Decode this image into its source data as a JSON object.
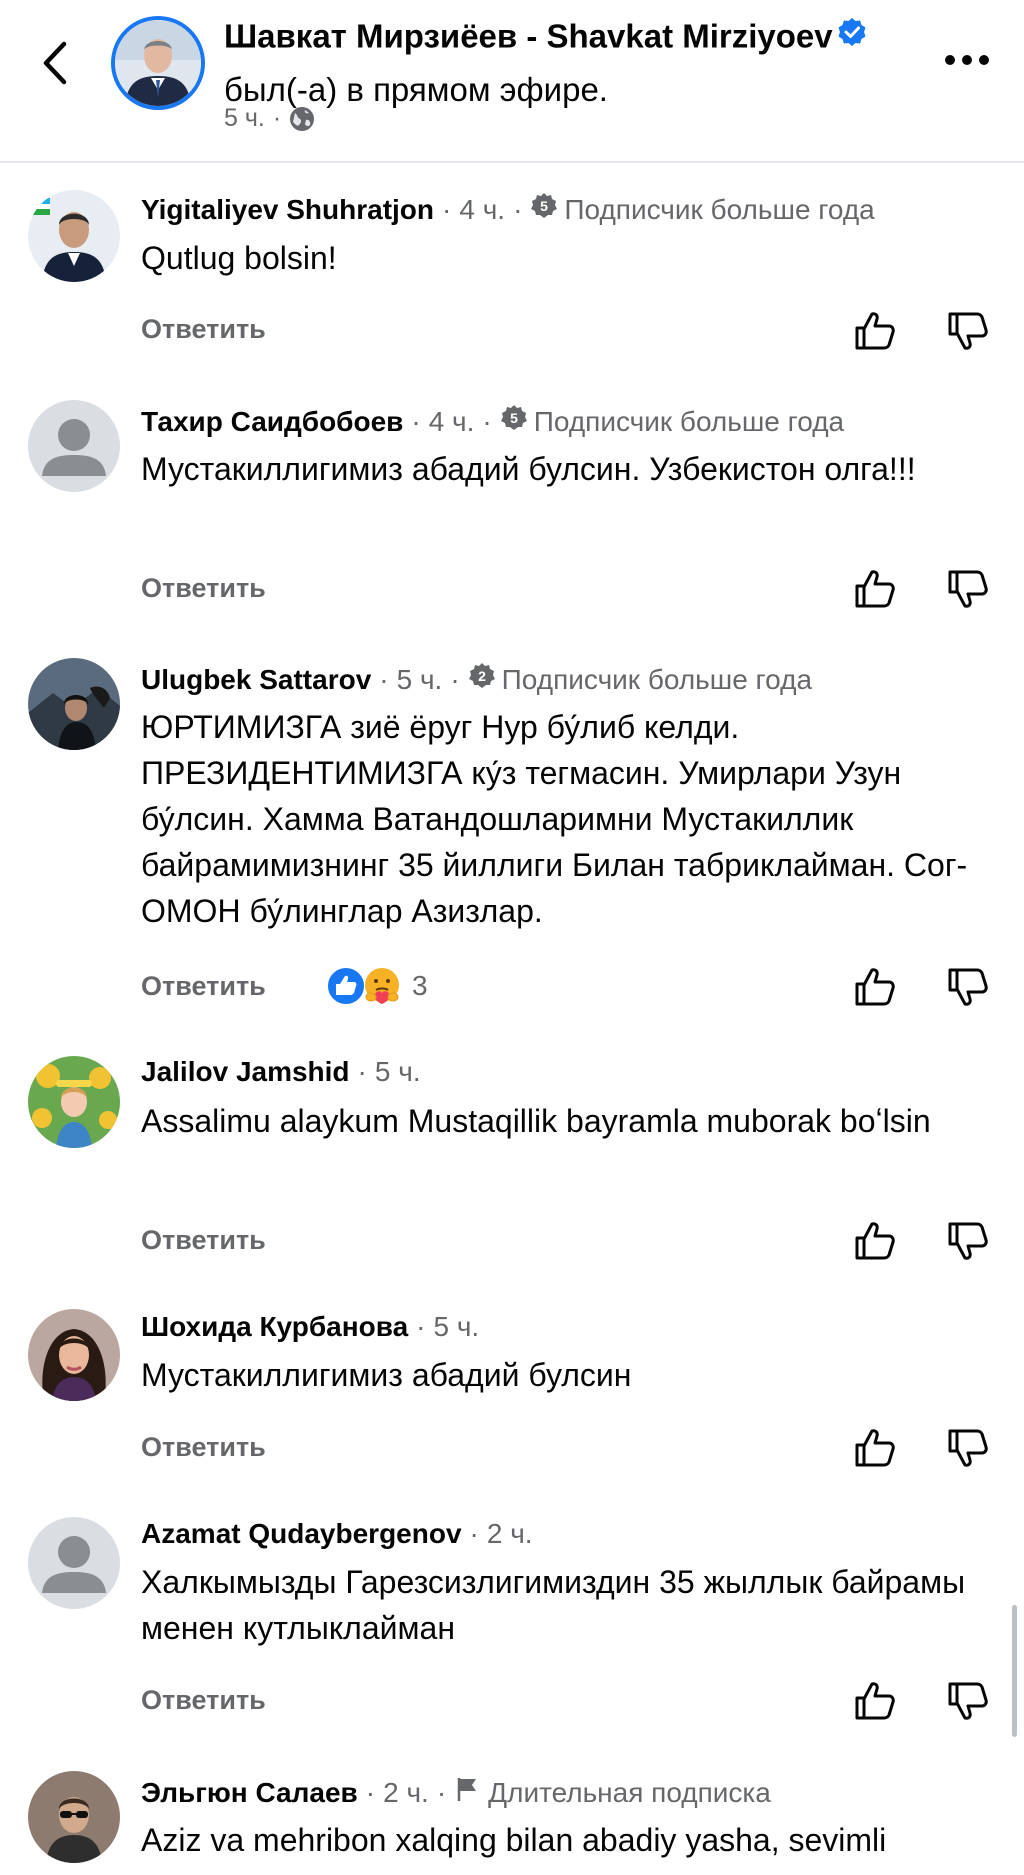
{
  "header": {
    "page_name": "Шавкат Мирзиёев - Shavkat Mirziyoev",
    "live_text": "был(-а) в прямом эфире.",
    "time": "5 ч.",
    "separator": "·",
    "icons": {
      "back": "chevron-left-icon",
      "verified": "verified-badge-icon",
      "audience": "globe-icon",
      "more": "more-horizontal-icon"
    }
  },
  "reply_label": "Ответить",
  "accent_color": "#1877f2",
  "comments": [
    {
      "name": "Yigitaliyev Shuhratjon",
      "time": "4 ч.",
      "badge_number": "5",
      "badge_text": "Подписчик больше года",
      "text": "Qutlug bolsin!"
    },
    {
      "name": "Тахир Саидбобоев",
      "time": "4 ч.",
      "badge_number": "5",
      "badge_text": "Подписчик больше года",
      "text": "Мустакиллигимиз абадий булсин. Узбекистон олга!!!"
    },
    {
      "name": "Ulugbek Sattarov",
      "time": "5 ч.",
      "badge_number": "2",
      "badge_text": "Подписчик больше года",
      "text": "ЮРТИМИЗГА зиё ёруг Нур бу́либ келди. ПРЕЗИДЕНТИМИЗГА ку́з тегмасин. Умирлари Узун бу́лсин. Хамма Ватандошларимни Мустакиллик байрамимизнинг 35 йиллиги Билан табриклайман. Сог- ОМОН бу́линглар Азизлар.",
      "reactions": {
        "types": [
          "like-reaction-icon",
          "care-reaction-icon"
        ],
        "count": "3"
      }
    },
    {
      "name": "Jalilov Jamshid",
      "time": "5 ч.",
      "text": "Assalimu alaykum Mustaqillik bayramla muborak boʻlsin"
    },
    {
      "name": "Шохида Курбанова",
      "time": "5 ч.",
      "text": "Мустакиллигимиз абадий булсин"
    },
    {
      "name": "Azamat Qudaybergenov",
      "time": "2 ч.",
      "text": "Халкымызды Гарезсизлигимиздин 35 жыллык байрамы менен кутлыклайман"
    },
    {
      "name": "Эльгюн Салаев",
      "time": "2 ч.",
      "badge_text": "Длительная подписка",
      "badge_icon": "flag-icon",
      "text": "Aziz va mehribon xalqing bilan abadiy yasha, sevimli"
    }
  ]
}
